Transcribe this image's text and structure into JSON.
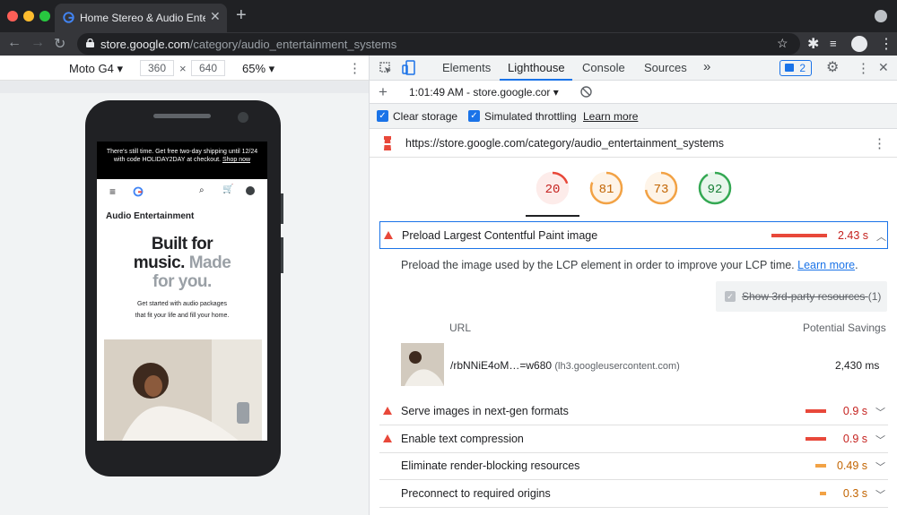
{
  "browser": {
    "tab_title": "Home Stereo & Audio Entertainment",
    "url_host": "store.google.com",
    "url_path": "/category/audio_entertainment_systems"
  },
  "device_toolbar": {
    "device": "Moto G4",
    "width": "360",
    "height": "640",
    "zoom": "65%"
  },
  "page": {
    "banner_text": "There's still time. Get free two-day shipping until 12/24 with code HOLIDAY2DAY at checkout.",
    "banner_link": "Shop now",
    "section_title": "Audio Entertainment",
    "hero_line1": "Built for",
    "hero_line2a": "music.",
    "hero_line2b": "Made",
    "hero_line3": "for you.",
    "subtitle": "Get started with audio packages that fit your life and fill your home."
  },
  "devtools": {
    "tabs": [
      "Elements",
      "Lighthouse",
      "Console",
      "Sources"
    ],
    "more": "»",
    "issues_count": "2",
    "report_select": "1:01:49 AM - store.google.cor",
    "clear_storage": "Clear storage",
    "simulated_throttling": "Simulated throttling",
    "learn_more": "Learn more",
    "report_url": "https://store.google.com/category/audio_entertainment_systems"
  },
  "scores": [
    {
      "value": "20",
      "color": "#e8483a",
      "fill": 0.2
    },
    {
      "value": "81",
      "color": "#f2a245",
      "fill": 0.81
    },
    {
      "value": "73",
      "color": "#f2a245",
      "fill": 0.73
    },
    {
      "value": "92",
      "color": "#34a853",
      "fill": 0.92
    }
  ],
  "audits": [
    {
      "label": "Preload Largest Contentful Paint image",
      "value": "2.43 s",
      "severity": "fail",
      "bar": 1.0
    },
    {
      "label": "Serve images in next-gen formats",
      "value": "0.9 s",
      "severity": "fail",
      "bar": 0.37
    },
    {
      "label": "Enable text compression",
      "value": "0.9 s",
      "severity": "fail",
      "bar": 0.37
    },
    {
      "label": "Eliminate render-blocking resources",
      "value": "0.49 s",
      "severity": "average",
      "bar": 0.2
    },
    {
      "label": "Preconnect to required origins",
      "value": "0.3 s",
      "severity": "average",
      "bar": 0.12
    }
  ],
  "audit_detail": {
    "description": "Preload the image used by the LCP element in order to improve your LCP time.",
    "learn_more": "Learn more",
    "third_party": "Show 3rd-party resources",
    "third_party_count": "(1)",
    "col_url": "URL",
    "col_savings": "Potential Savings",
    "row_url": "/rbNNiE4oM…=w680",
    "row_host": "(lh3.googleusercontent.com)",
    "row_savings": "2,430 ms"
  }
}
